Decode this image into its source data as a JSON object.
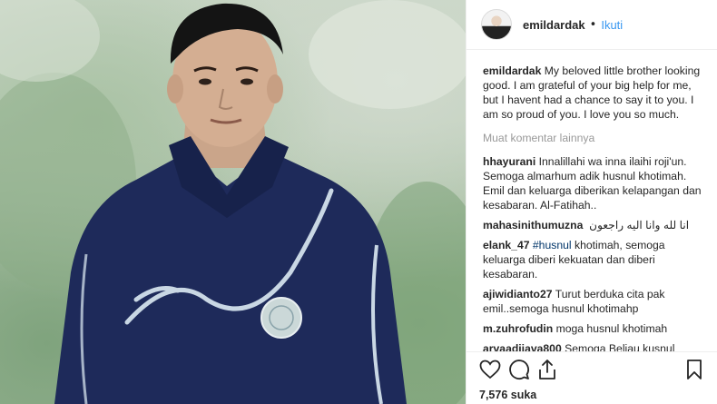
{
  "post": {
    "username": "emildardak",
    "separator": "•",
    "follow_label": "Ikuti",
    "caption_user": "emildardak",
    "caption_text": "My beloved little brother looking good. I am grateful of your big help for me, but I havent had a chance to say it to you. I am so proud of you. I love you so much.",
    "more_comments_label": "Muat komentar lainnya",
    "likes_count": "7,576",
    "likes_label": "suka"
  },
  "comments": [
    {
      "user": "hhayurani",
      "text": "Innalillahi wa inna ilaihi roji'un. Semoga almarhum adik husnul khotimah. Emil dan keluarga diberikan kelapangan dan kesabaran. Al-Fatihah.."
    },
    {
      "user": "mahasinithumuzna",
      "text": "انا لله وانا اليه راجعون"
    },
    {
      "user": "elank_47",
      "tag": "#husnul",
      "text": "khotimah, semoga keluarga diberi kekuatan dan diberi kesabaran."
    },
    {
      "user": "ajiwidianto27",
      "text": "Turut berduka cita pak emil..semoga husnul khotimahp"
    },
    {
      "user": "m.zuhrofudin",
      "text": "moga husnul khotimah"
    },
    {
      "user": "arvaadiiava800",
      "text": "Semoga Beliau kusnul"
    }
  ],
  "icons": {
    "like": "heart-icon",
    "comment": "comment-icon",
    "share": "share-icon",
    "save": "bookmark-icon"
  },
  "colors": {
    "follow": "#3897f0",
    "jacket": "#1e2a5a",
    "border": "#efefef"
  }
}
